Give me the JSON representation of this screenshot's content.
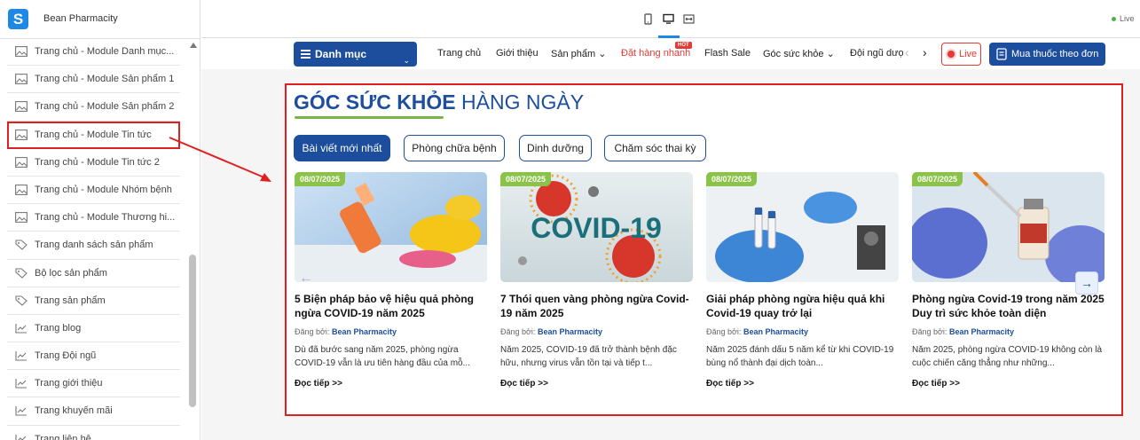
{
  "app": {
    "name": "Bean Pharmacity",
    "logo_letter": "S",
    "live_indicator": "Live"
  },
  "toolbar": {
    "devices": [
      "mobile-icon",
      "desktop-icon",
      "fullwidth-icon"
    ]
  },
  "sidebar": {
    "items": [
      {
        "label": "Trang chủ - Module Danh mục...",
        "icon": "image-icon"
      },
      {
        "label": "Trang chủ - Module Sản phẩm 1",
        "icon": "image-icon"
      },
      {
        "label": "Trang chủ - Module Sản phẩm 2",
        "icon": "image-icon"
      },
      {
        "label": "Trang chủ - Module Tin tức",
        "icon": "image-icon",
        "selected": true
      },
      {
        "label": "Trang chủ - Module Tin tức 2",
        "icon": "image-icon"
      },
      {
        "label": "Trang chủ - Module Nhóm bệnh",
        "icon": "image-icon"
      },
      {
        "label": "Trang chủ - Module Thương hi...",
        "icon": "image-icon"
      },
      {
        "label": "Trang danh sách sản phẩm",
        "icon": "tag-icon"
      },
      {
        "label": "Bộ lọc sản phẩm",
        "icon": "tag-icon"
      },
      {
        "label": "Trang sản phẩm",
        "icon": "tag-icon"
      },
      {
        "label": "Trang blog",
        "icon": "chart-icon"
      },
      {
        "label": "Trang Đội ngũ",
        "icon": "chart-icon"
      },
      {
        "label": "Trang giới thiệu",
        "icon": "chart-icon"
      },
      {
        "label": "Trang khuyến mãi",
        "icon": "chart-icon"
      },
      {
        "label": "Trang liên hệ",
        "icon": "chart-icon"
      }
    ]
  },
  "nav": {
    "category_button": "Danh mục",
    "links": [
      "Trang chủ",
      "Giới thiệu",
      "Sản phẩm",
      "Đặt hàng nhanh",
      "Flash Sale",
      "Góc sức khỏe",
      "Đội ngũ dược"
    ],
    "hot_badge": "HOT",
    "live_button": "Live",
    "buy_button": "Mua thuốc theo đơn"
  },
  "module": {
    "title_bold": "GÓC SỨC KHỎE",
    "title_normal": "HÀNG NGÀY",
    "tabs": [
      "Bài viết mới nhất",
      "Phòng chữa bệnh",
      "Dinh dưỡng",
      "Chăm sóc thai kỳ"
    ],
    "active_tab": 0,
    "byline_prefix": "Đăng bởi:",
    "read_more": "Đọc tiếp >>",
    "posts": [
      {
        "date": "08/07/2025",
        "title": "5 Biện pháp bảo vệ hiệu quả phòng ngừa COVID-19 năm 2025",
        "author": "Bean Pharmacity",
        "excerpt": "Dù đã bước sang năm 2025, phòng ngừa COVID-19 vẫn là ưu tiên hàng đầu của mỗ..."
      },
      {
        "date": "08/07/2025",
        "title": "7 Thói quen vàng phòng ngừa Covid-19 năm 2025",
        "author": "Bean Pharmacity",
        "excerpt": "Năm 2025, COVID-19 đã trở thành bệnh đặc hữu, nhưng virus vẫn tồn tại và tiếp t..."
      },
      {
        "date": "08/07/2025",
        "title": "Giải pháp phòng ngừa hiệu quả khi Covid-19 quay trở lại",
        "author": "Bean Pharmacity",
        "excerpt": "Năm 2025 đánh dấu 5 năm kể từ khi COVID-19 bùng nổ thành đại dịch toàn..."
      },
      {
        "date": "08/07/2025",
        "title": "Phòng ngừa Covid-19 trong năm 2025 Duy trì sức khỏe toàn diện",
        "author": "Bean Pharmacity",
        "excerpt": "Năm 2025, phòng ngừa COVID-19 không còn là cuộc chiến căng thẳng như những..."
      }
    ],
    "covid_image_text": "COVID-19"
  },
  "colors": {
    "brand": "#1d4e9e",
    "accent_green": "#7cb342",
    "highlight_red": "#e02020",
    "hot_red": "#e53935"
  }
}
